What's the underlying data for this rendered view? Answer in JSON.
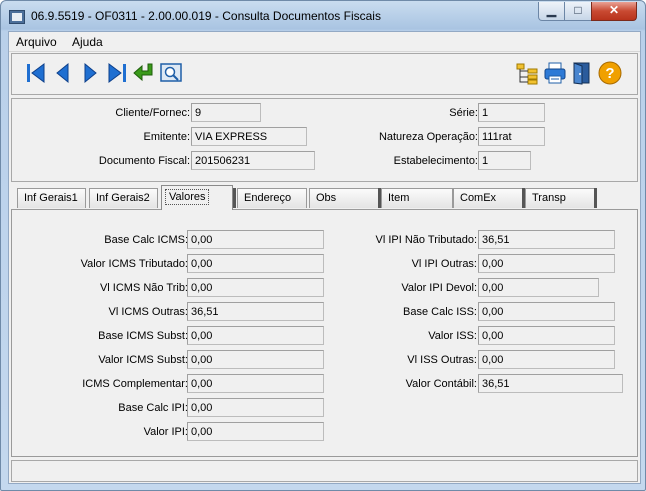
{
  "window": {
    "title": "06.9.5519 - OF0311 - 2.00.00.019 - Consulta Documentos Fiscais",
    "min_glyph": "▁",
    "max_glyph": "□",
    "close_glyph": "✕"
  },
  "menu": {
    "items": [
      "Arquivo",
      "Ajuda"
    ]
  },
  "toolbar": {
    "icons": [
      "first-record-icon",
      "previous-record-icon",
      "next-record-icon",
      "last-record-icon",
      "confirm-enter-icon",
      "view-detail-icon",
      "tree-structure-icon",
      "printer-icon",
      "exit-door-icon",
      "help-icon"
    ],
    "help_glyph": "?"
  },
  "header": {
    "cliente_fornec": {
      "label": "Cliente/Fornec:",
      "value": "9"
    },
    "emitente": {
      "label": "Emitente:",
      "value": "VIA EXPRESS"
    },
    "documento_fiscal": {
      "label": "Documento Fiscal:",
      "value": "201506231"
    },
    "serie": {
      "label": "Série:",
      "value": "1"
    },
    "natureza_operacao": {
      "label": "Natureza Operação:",
      "value": "111rat"
    },
    "estabelecimento": {
      "label": "Estabelecimento:",
      "value": "1"
    }
  },
  "tabs": [
    "Inf Gerais1",
    "Inf Gerais2",
    "Valores",
    "Endereço",
    "Obs",
    "Item",
    "ComEx",
    "Transp"
  ],
  "active_tab": "Valores",
  "valores_left": [
    {
      "label": "Base Calc ICMS:",
      "value": "0,00"
    },
    {
      "label": "Valor ICMS Tributado:",
      "value": "0,00"
    },
    {
      "label": "Vl  ICMS Não Trib:",
      "value": "0,00"
    },
    {
      "label": "Vl ICMS Outras:",
      "value": "36,51"
    },
    {
      "label": "Base ICMS Subst:",
      "value": "0,00"
    },
    {
      "label": "Valor ICMS Subst:",
      "value": "0,00"
    },
    {
      "label": "ICMS Complementar:",
      "value": "0,00"
    },
    {
      "label": "Base Calc IPI:",
      "value": "0,00"
    },
    {
      "label": "Valor IPI:",
      "value": "0,00"
    }
  ],
  "valores_right": [
    {
      "label": "Vl IPI Não Tributado:",
      "value": "36,51"
    },
    {
      "label": "Vl IPI Outras:",
      "value": "0,00"
    },
    {
      "label": "Valor IPI Devol:",
      "value": "0,00"
    },
    {
      "label": "Base Calc ISS:",
      "value": "0,00"
    },
    {
      "label": "Valor ISS:",
      "value": "0,00"
    },
    {
      "label": "Vl  ISS Outras:",
      "value": "0,00"
    },
    {
      "label": "Valor Contábil:",
      "value": "36,51"
    }
  ],
  "colors": {
    "accent_blue": "#1f6fd1",
    "help_orange": "#f0a000",
    "confirm_green": "#3a9a1a"
  }
}
